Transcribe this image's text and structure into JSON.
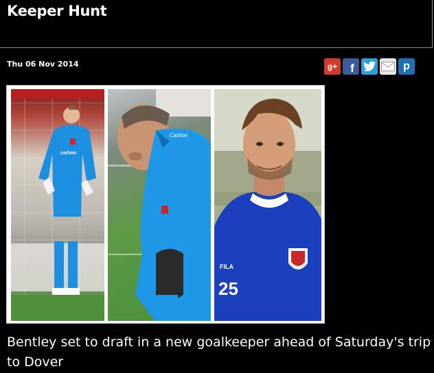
{
  "page": {
    "title": "Keeper Hunt"
  },
  "post": {
    "date": "Thu 06 Nov 2014",
    "headline": "Bentley set to draft in a new goalkeeper ahead of Saturday's trip to Dover"
  },
  "share": {
    "buttons": [
      {
        "name": "google-plus",
        "label": "g+",
        "color": "#d13b2b"
      },
      {
        "name": "facebook",
        "label": "f",
        "color": "#3b5b99"
      },
      {
        "name": "twitter",
        "label": "",
        "color": "#2b9fd9"
      },
      {
        "name": "email",
        "label": "",
        "color": "#e7e7e7"
      },
      {
        "name": "pinterest",
        "label": "p",
        "color": "#1c6fb3"
      }
    ]
  },
  "photo": {
    "panels": [
      {
        "name": "photo-goalkeeper-green-kit"
      },
      {
        "name": "photo-goalkeeper-closeup"
      },
      {
        "name": "photo-player-number-25"
      }
    ],
    "shirt_text": {
      "sponsor": "carbon",
      "number": "25",
      "brand": "FILA"
    }
  }
}
